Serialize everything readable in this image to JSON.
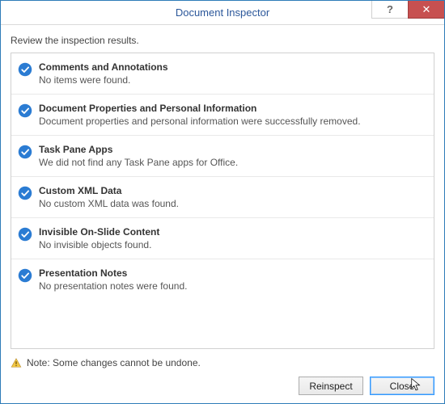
{
  "window": {
    "title": "Document Inspector",
    "help_symbol": "?",
    "close_symbol": "✕"
  },
  "instruction": "Review the inspection results.",
  "results": [
    {
      "title": "Comments and Annotations",
      "desc": "No items were found."
    },
    {
      "title": "Document Properties and Personal Information",
      "desc": "Document properties and personal information were successfully removed."
    },
    {
      "title": "Task Pane Apps",
      "desc": "We did not find any Task Pane apps for Office."
    },
    {
      "title": "Custom XML Data",
      "desc": "No custom XML data was found."
    },
    {
      "title": "Invisible On-Slide Content",
      "desc": "No invisible objects found."
    },
    {
      "title": "Presentation Notes",
      "desc": "No presentation notes were found."
    }
  ],
  "note": "Note: Some changes cannot be undone.",
  "buttons": {
    "reinspect": "Reinspect",
    "close": "Close"
  }
}
